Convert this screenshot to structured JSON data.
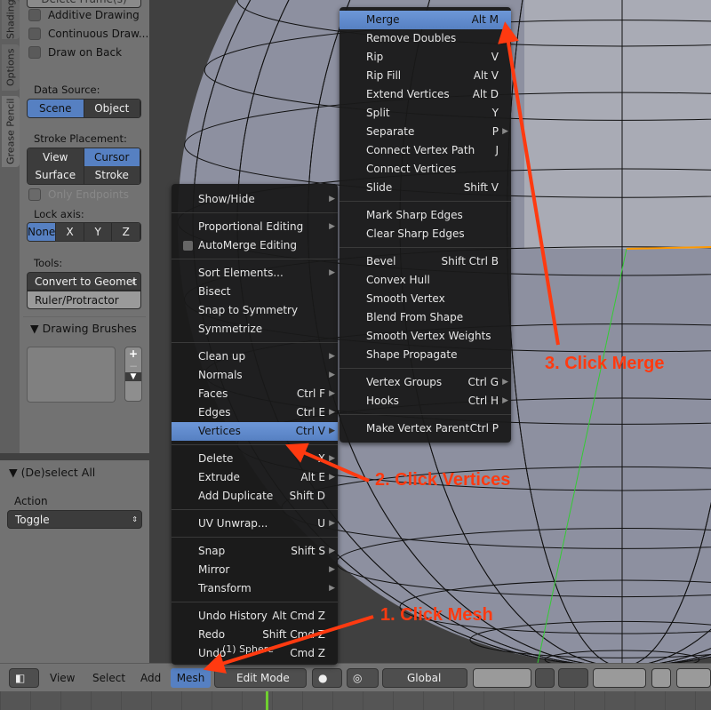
{
  "left_panel": {
    "tabs": [
      "Shading",
      "Options",
      "Grease Pencil"
    ],
    "top_cut_button": "Delete Frame(s)",
    "checkboxes": [
      "Additive Drawing",
      "Continuous Draw...",
      "Draw on Back"
    ],
    "data_source_label": "Data Source:",
    "data_source": [
      "Scene",
      "Object"
    ],
    "data_source_selected": "Scene",
    "stroke_placement_label": "Stroke Placement:",
    "stroke_placement": [
      "View",
      "Cursor",
      "Surface",
      "Stroke"
    ],
    "stroke_placement_selected": "Cursor",
    "only_endpoints": "Only Endpoints",
    "lock_axis_label": "Lock axis:",
    "lock_axis": [
      "None",
      "X",
      "Y",
      "Z"
    ],
    "lock_axis_selected": "None",
    "tools_label": "Tools:",
    "tools_dropdown": "Convert to Geomet",
    "tools_button": "Ruler/Protractor",
    "brushes_header": "Drawing Brushes"
  },
  "operator_panel": {
    "header": "(De)select All",
    "action_label": "Action",
    "action_value": "Toggle"
  },
  "viewport": {
    "object_label": "(1) Sphere"
  },
  "header": {
    "menus": [
      "View",
      "Select",
      "Add",
      "Mesh"
    ],
    "active_menu": "Mesh",
    "mode": "Edit Mode",
    "orientation": "Global"
  },
  "mesh_menu": [
    {
      "label": "Show/Hide",
      "arrow": true
    },
    "sep",
    {
      "label": "Proportional Editing",
      "arrow": true
    },
    {
      "label": "AutoMerge Editing",
      "checkbox": true
    },
    "sep",
    {
      "label": "Sort Elements...",
      "arrow": true
    },
    {
      "label": "Bisect"
    },
    {
      "label": "Snap to Symmetry"
    },
    {
      "label": "Symmetrize"
    },
    "sep",
    {
      "label": "Clean up",
      "arrow": true
    },
    {
      "label": "Normals",
      "arrow": true
    },
    {
      "label": "Faces",
      "shortcut": "Ctrl F",
      "arrow": true
    },
    {
      "label": "Edges",
      "shortcut": "Ctrl E",
      "arrow": true
    },
    {
      "label": "Vertices",
      "shortcut": "Ctrl V",
      "arrow": true,
      "highlight": true
    },
    "sep",
    {
      "label": "Delete",
      "shortcut": "X",
      "arrow": true
    },
    {
      "label": "Extrude",
      "shortcut": "Alt E",
      "arrow": true
    },
    {
      "label": "Add Duplicate",
      "shortcut": "Shift D"
    },
    "sep",
    {
      "label": "UV Unwrap...",
      "shortcut": "U",
      "arrow": true
    },
    "sep",
    {
      "label": "Snap",
      "shortcut": "Shift S",
      "arrow": true
    },
    {
      "label": "Mirror",
      "arrow": true
    },
    {
      "label": "Transform",
      "arrow": true
    },
    "sep",
    {
      "label": "Undo History",
      "shortcut": "Alt Cmd Z"
    },
    {
      "label": "Redo",
      "shortcut": "Shift Cmd Z"
    },
    {
      "label": "Undo",
      "shortcut": "Cmd Z"
    }
  ],
  "vertices_menu": [
    {
      "label": "Merge",
      "shortcut": "Alt M",
      "highlight": true
    },
    {
      "label": "Remove Doubles"
    },
    {
      "label": "Rip",
      "shortcut": "V"
    },
    {
      "label": "Rip Fill",
      "shortcut": "Alt V"
    },
    {
      "label": "Extend Vertices",
      "shortcut": "Alt D"
    },
    {
      "label": "Split",
      "shortcut": "Y"
    },
    {
      "label": "Separate",
      "shortcut": "P",
      "arrow": true
    },
    {
      "label": "Connect Vertex Path",
      "shortcut": "J"
    },
    {
      "label": "Connect Vertices"
    },
    {
      "label": "Slide",
      "shortcut": "Shift V"
    },
    "sep",
    {
      "label": "Mark Sharp Edges"
    },
    {
      "label": "Clear Sharp Edges"
    },
    "sep",
    {
      "label": "Bevel",
      "shortcut": "Shift Ctrl B"
    },
    {
      "label": "Convex Hull"
    },
    {
      "label": "Smooth Vertex"
    },
    {
      "label": "Blend From Shape"
    },
    {
      "label": "Smooth Vertex Weights"
    },
    {
      "label": "Shape Propagate"
    },
    "sep",
    {
      "label": "Vertex Groups",
      "shortcut": "Ctrl G",
      "arrow": true
    },
    {
      "label": "Hooks",
      "shortcut": "Ctrl H",
      "arrow": true
    },
    "sep",
    {
      "label": "Make Vertex Parent",
      "shortcut": "Ctrl P"
    }
  ],
  "annotations": [
    "1. Click Mesh",
    "2. Click Vertices",
    "3. Click Merge"
  ],
  "colors": {
    "highlight": "#5680c2",
    "annotation": "#ff3a10",
    "menu_bg": "#191919"
  }
}
